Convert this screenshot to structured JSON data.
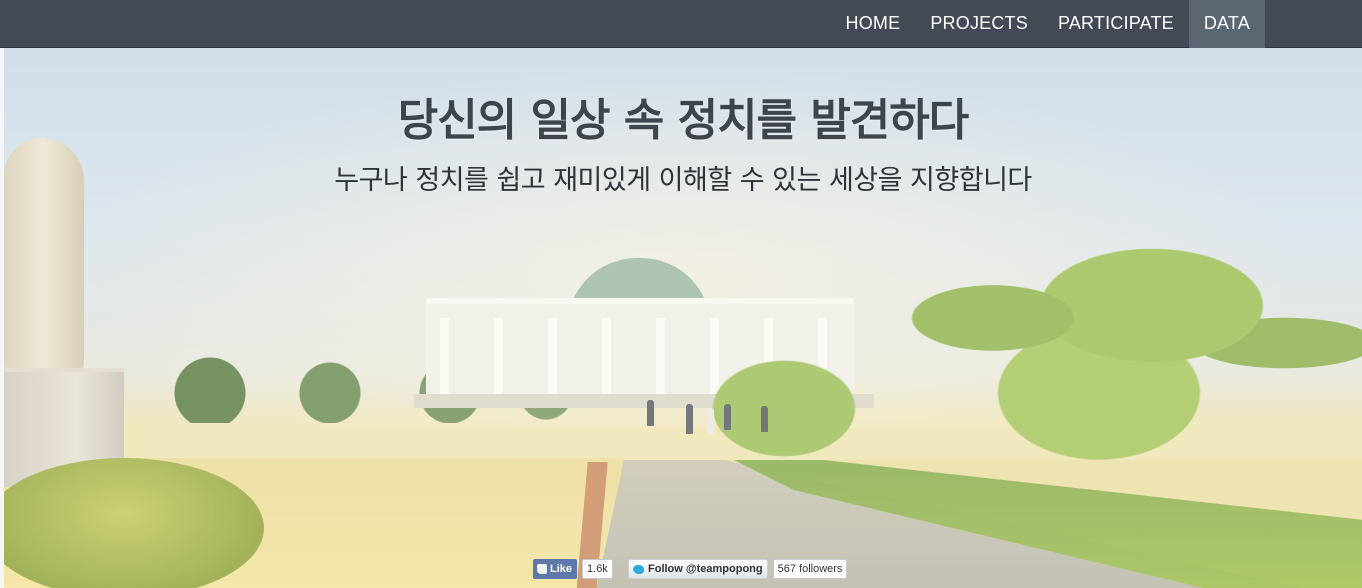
{
  "nav": {
    "items": [
      {
        "label": "HOME"
      },
      {
        "label": "PROJECTS"
      },
      {
        "label": "PARTICIPATE"
      },
      {
        "label": "DATA",
        "active": true
      }
    ],
    "background": "#434a55",
    "active_background": "#5b6673"
  },
  "hero": {
    "title": "당신의 일상 속 정치를 발견하다",
    "subtitle": "누구나 정치를 쉽고 재미있게 이해할 수 있는 세상을 지향합니다"
  },
  "social": {
    "facebook": {
      "label": "Like",
      "count": "1.6k",
      "icon": "thumbs-up-icon",
      "color": "#5f78ab"
    },
    "twitter": {
      "label": "Follow @teampopong",
      "count": "567 followers",
      "icon": "twitter-bird-icon",
      "color": "#2ba8e0"
    }
  }
}
